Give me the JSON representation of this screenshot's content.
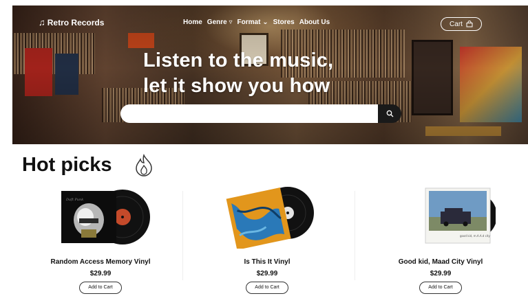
{
  "header": {
    "brand": "Retro Records",
    "nav": [
      "Home",
      "Genre",
      "Format",
      "Stores",
      "About Us"
    ],
    "cart_label": "Cart"
  },
  "hero": {
    "headline_line1": "Listen to the music,",
    "headline_line2": "let it show you how",
    "search_placeholder": ""
  },
  "hot_picks": {
    "title": "Hot picks",
    "products": [
      {
        "name": "Random Access Memory Vinyl",
        "price": "$29.99",
        "button": "Add to Cart"
      },
      {
        "name": "Is This It Vinyl",
        "price": "$29.99",
        "button": "Add to Cart"
      },
      {
        "name": "Good kid, Maad City Vinyl",
        "price": "$29.99",
        "button": "Add to Cart"
      }
    ]
  },
  "colors": {
    "accent": "#1a1a1a",
    "text": "#111111",
    "background": "#ffffff"
  }
}
